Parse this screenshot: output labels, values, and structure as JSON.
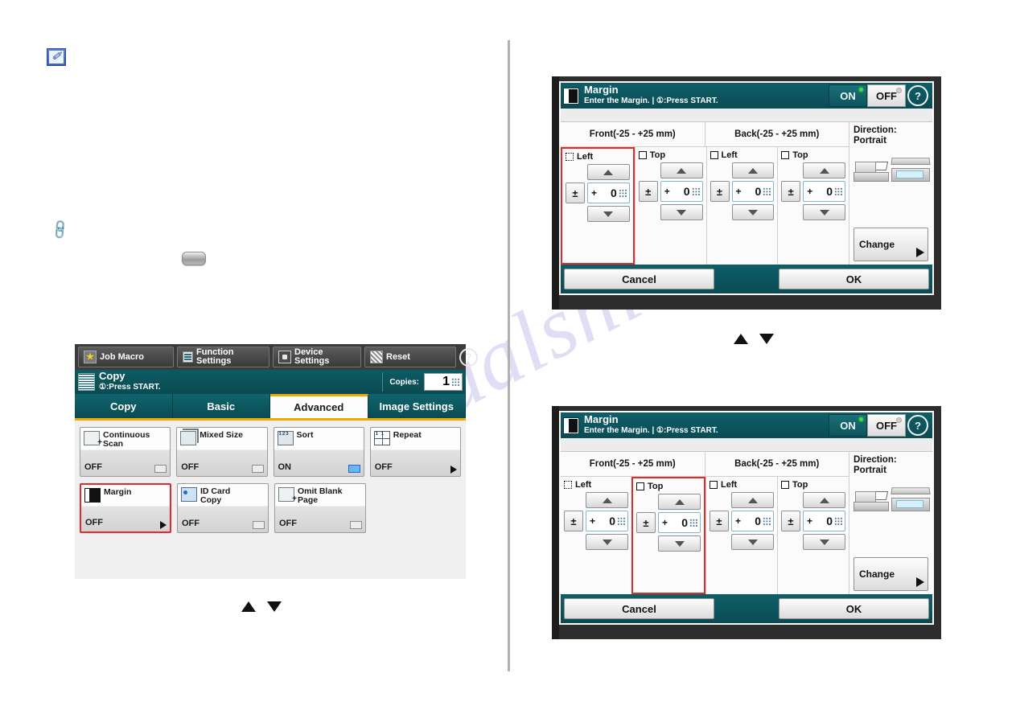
{
  "document": {
    "watermark": "manualshive.com",
    "icons": {
      "memo": "memo-note-icon",
      "memo_glyph": "✐",
      "link": "chain-link-icon",
      "link_glyph": "⛓",
      "hardware_key": "rounded-key-button"
    }
  },
  "arrows": {
    "up": "▲",
    "down": "▼"
  },
  "copy_panel": {
    "toolbar": [
      {
        "label": "Job Macro",
        "icon": "star-icon"
      },
      {
        "label": "Function\nSettings",
        "icon": "list-icon"
      },
      {
        "label": "Device\nSettings",
        "icon": "device-icon"
      },
      {
        "label": "Reset",
        "icon": "reset-icon"
      }
    ],
    "help_glyph": "?",
    "title": "Copy",
    "subtitle": "①:Press START.",
    "copies_label": "Copies:",
    "copies_value": "1",
    "tabs": [
      {
        "label": "Copy",
        "active": false
      },
      {
        "label": "Basic",
        "active": false
      },
      {
        "label": "Advanced",
        "active": true
      },
      {
        "label": "Image Settings",
        "active": false
      }
    ],
    "tiles": [
      {
        "label": "Continuous\nScan",
        "value": "OFF",
        "indicator": "checkbox",
        "icon": "continuous-scan-icon"
      },
      {
        "label": "Mixed Size",
        "value": "OFF",
        "indicator": "checkbox",
        "icon": "mixed-size-icon"
      },
      {
        "label": "Sort",
        "value": "ON",
        "indicator": "checkbox-on",
        "icon": "sort-icon"
      },
      {
        "label": "Repeat",
        "value": "OFF",
        "indicator": "caret",
        "icon": "repeat-icon"
      },
      {
        "label": "Margin",
        "value": "OFF",
        "indicator": "caret",
        "icon": "margin-icon",
        "selected": true
      },
      {
        "label": "ID Card\nCopy",
        "value": "OFF",
        "indicator": "checkbox",
        "icon": "id-card-icon"
      },
      {
        "label": "Omit Blank\nPage",
        "value": "OFF",
        "indicator": "checkbox",
        "icon": "omit-blank-page-icon"
      }
    ]
  },
  "margin_dialog": {
    "title": "Margin",
    "subtitle": "Enter the Margin. | ①:Press START.",
    "toggle": {
      "on_label": "ON",
      "off_label": "OFF",
      "selected": "OFF"
    },
    "help_glyph": "?",
    "front_header": "Front(-25 - +25 mm)",
    "back_header": "Back(-25 - +25 mm)",
    "columns": [
      {
        "label": "Left",
        "sign": "+",
        "value": "0",
        "side": "front"
      },
      {
        "label": "Top",
        "sign": "+",
        "value": "0",
        "side": "front"
      },
      {
        "label": "Left",
        "sign": "+",
        "value": "0",
        "side": "back"
      },
      {
        "label": "Top",
        "sign": "+",
        "value": "0",
        "side": "back"
      }
    ],
    "sign_toggle_glyph": "±",
    "direction_label": "Direction:",
    "direction_value": "Portrait",
    "change_label": "Change",
    "cancel_label": "Cancel",
    "ok_label": "OK"
  },
  "margin_dialog_top": {
    "title": "Margin",
    "subtitle": "Enter the Margin. | ①:Press START.",
    "toggle": {
      "on_label": "ON",
      "off_label": "OFF",
      "selected": "OFF"
    },
    "help_glyph": "?",
    "front_header": "Front(-25 - +25 mm)",
    "back_header": "Back(-25 - +25 mm)",
    "columns": [
      {
        "label": "Left",
        "sign": "+",
        "value": "0",
        "side": "front"
      },
      {
        "label": "Top",
        "sign": "+",
        "value": "0",
        "side": "front"
      },
      {
        "label": "Left",
        "sign": "+",
        "value": "0",
        "side": "back"
      },
      {
        "label": "Top",
        "sign": "+",
        "value": "0",
        "side": "back"
      }
    ],
    "sign_toggle_glyph": "±",
    "direction_label": "Direction:",
    "direction_value": "Portrait",
    "change_label": "Change",
    "cancel_label": "Cancel",
    "ok_label": "OK"
  }
}
